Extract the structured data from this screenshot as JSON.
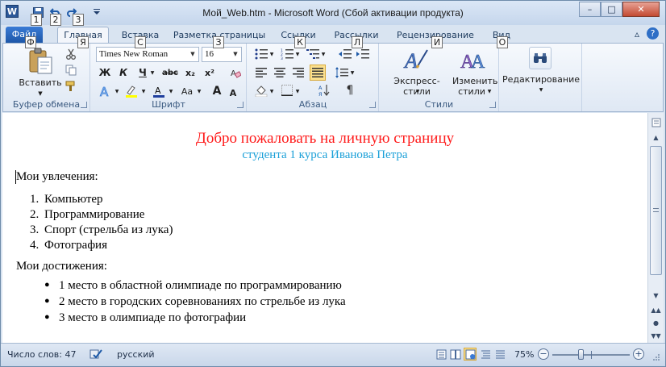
{
  "titlebar": {
    "app_icon": "W",
    "title": "Мой_Web.htm - Microsoft Word (Сбой активации продукта)",
    "qat_keytips": [
      "1",
      "2",
      "3"
    ],
    "minimize": "–",
    "maximize": "□",
    "close": "✕"
  },
  "tabs": {
    "file": "Файл",
    "items": [
      "Главная",
      "Вставка",
      "Разметка страницы",
      "Ссылки",
      "Рассылки",
      "Рецензирование",
      "Вид"
    ],
    "keytips": [
      "Ф",
      "Я",
      "С",
      "З",
      "К",
      "Л",
      "И",
      "О"
    ]
  },
  "ribbon": {
    "clipboard": {
      "paste": "Вставить",
      "label": "Буфер обмена"
    },
    "font": {
      "family": "Times New Roman",
      "size": "16",
      "bold": "Ж",
      "italic": "К",
      "underline": "Ч",
      "strike": "abc",
      "subscript": "x₂",
      "superscript": "x²",
      "grow": "A",
      "shrink": "A",
      "case": "Aa",
      "label": "Шрифт"
    },
    "paragraph": {
      "label": "Абзац"
    },
    "styles": {
      "express": "Экспресс-стили",
      "change_1": "Изменить",
      "change_2": "стили",
      "label": "Стили"
    },
    "editing": {
      "label": "Редактирование"
    }
  },
  "document": {
    "title": "Добро пожаловать на личную страницу",
    "subtitle": "студента 1 курса Иванова Петра",
    "hobbies_heading": "Мои увлечения:",
    "hobbies": [
      "Компьютер",
      "Программирование",
      "Спорт (стрельба из лука)",
      "Фотография"
    ],
    "achievements_heading": "Мои достижения:",
    "achievements": [
      "1 место в областной олимпиаде по программированию",
      "2 место в городских соревнованиях по стрельбе из лука",
      "3 место в олимпиаде по фотографии"
    ]
  },
  "statusbar": {
    "word_count": "Число слов: 47",
    "language": "русский",
    "zoom": "75%",
    "zoom_level": 0.75
  },
  "colors": {
    "title": "#ff1a1a",
    "subtitle": "#1ba0d8",
    "file_tab": "#1d57a8"
  }
}
